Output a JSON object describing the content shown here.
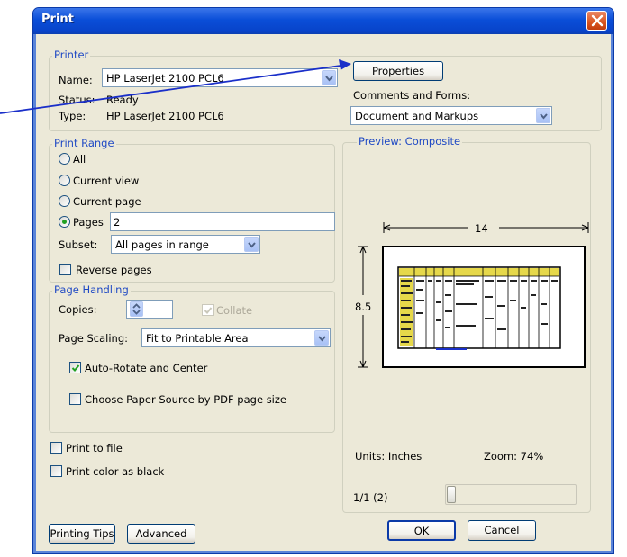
{
  "window": {
    "title": "Print",
    "close_icon": "close-icon"
  },
  "printer": {
    "legend": "Printer",
    "name_label": "Name:",
    "name_value": "HP LaserJet 2100 PCL6",
    "status_label": "Status:",
    "status_value": "Ready",
    "type_label": "Type:",
    "type_value": "HP LaserJet 2100 PCL6",
    "properties_label": "Properties",
    "comments_label": "Comments and Forms:",
    "comments_value": "Document and Markups"
  },
  "print_range": {
    "legend": "Print Range",
    "all_label": "All",
    "current_view_label": "Current view",
    "current_page_label": "Current page",
    "pages_label": "Pages",
    "pages_value": "2",
    "selected": "pages",
    "subset_label": "Subset:",
    "subset_value": "All pages in range",
    "reverse_label": "Reverse pages",
    "reverse_checked": false
  },
  "page_handling": {
    "legend": "Page Handling",
    "copies_label": "Copies:",
    "copies_value": "1",
    "collate_label": "Collate",
    "collate_checked": true,
    "collate_enabled": false,
    "scaling_label": "Page Scaling:",
    "scaling_value": "Fit to Printable Area",
    "auto_rotate_label": "Auto-Rotate and Center",
    "auto_rotate_checked": true,
    "paper_source_label": "Choose Paper Source by PDF page size",
    "paper_source_checked": false
  },
  "output": {
    "print_to_file_label": "Print to file",
    "print_to_file_checked": false,
    "color_black_label": "Print color as black",
    "color_black_checked": false
  },
  "preview": {
    "legend": "Preview: Composite",
    "width_value": "14",
    "height_value": "8.5",
    "units_label": "Units: Inches",
    "zoom_label": "Zoom:  74%",
    "page_indicator": "1/1 (2)",
    "slider_fraction": 0
  },
  "buttons": {
    "printing_tips": "Printing Tips",
    "advanced": "Advanced",
    "ok": "OK",
    "cancel": "Cancel"
  },
  "colors": {
    "titlebar": "#0a4ed8",
    "legend_text": "#1f49c4",
    "dialog_face": "#ece9d8",
    "annotation_arrow": "#1a2fc9"
  }
}
